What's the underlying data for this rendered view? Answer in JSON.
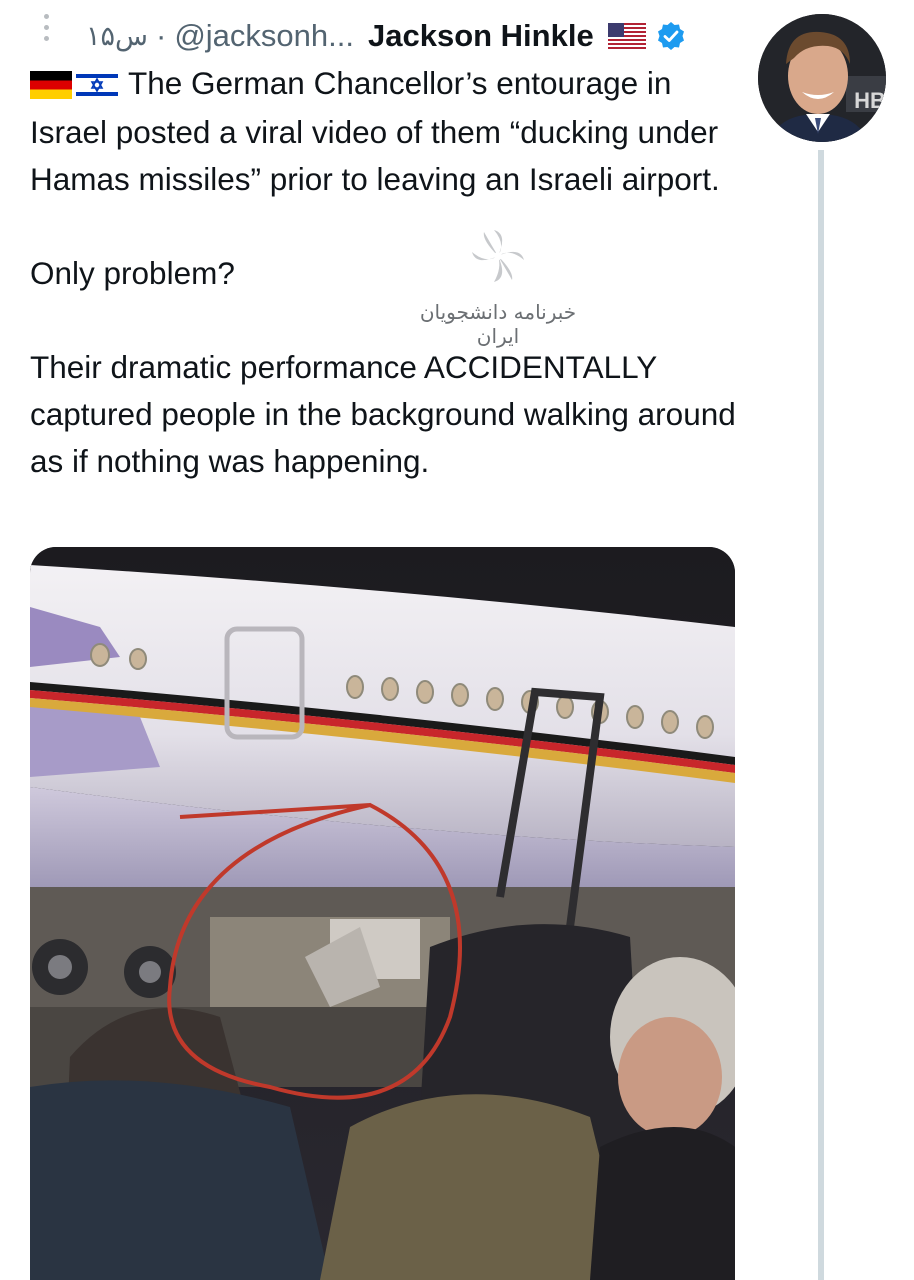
{
  "tweet": {
    "time": "۱۵س",
    "separator": "·",
    "handle": "@jacksonh...",
    "display_name": "Jackson Hinkle",
    "flag_icon": "us-flag-icon",
    "verified_icon": "verified-badge-icon",
    "verified_color": "#1d9bf0",
    "text": {
      "line1_flags": [
        "germany-flag-icon",
        "israel-flag-icon"
      ],
      "paragraph1": "The German Chancellor’s entourage in Israel posted a viral video of them “ducking under Hamas missiles” prior to leaving an Israeli airport.",
      "paragraph2": "Only problem?",
      "paragraph3": "Their dramatic performance ACCIDENTALLY captured people in the background walking around as if nothing was happening."
    }
  },
  "watermark": {
    "text": "خبرنامه دانشجویان ایران"
  },
  "colors": {
    "text": "#0f1419",
    "secondary": "#536471",
    "thread_line": "#cfd9de",
    "circle_annotation": "#c0392b"
  }
}
